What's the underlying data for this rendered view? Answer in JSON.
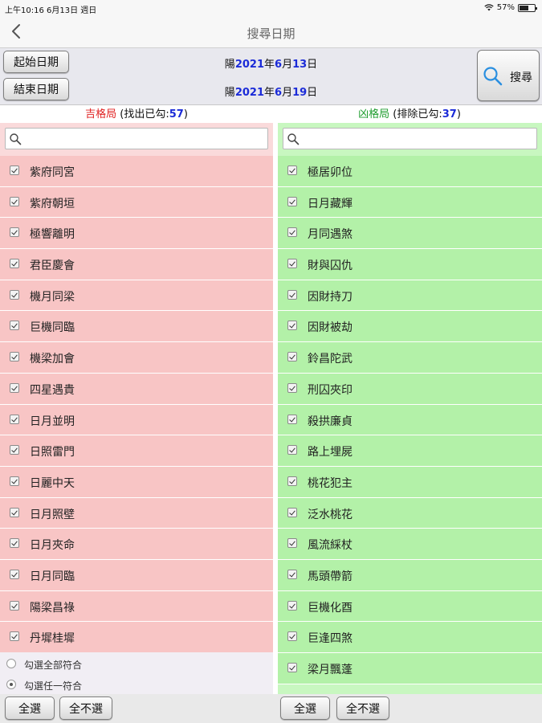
{
  "status_bar": {
    "time_date": "上午10:16  6月13日 週日",
    "battery": "57%"
  },
  "nav": {
    "title": "搜尋日期"
  },
  "date_bar": {
    "start_button": "起始日期",
    "end_button": "結束日期",
    "start_prefix": "陽",
    "start_year": "2021",
    "start_y_suffix": "年",
    "start_month": "6",
    "start_m_suffix": "月",
    "start_day": "13",
    "start_d_suffix": "日",
    "end_prefix": "陽",
    "end_year": "2021",
    "end_y_suffix": "年",
    "end_month": "6",
    "end_m_suffix": "月",
    "end_day": "19",
    "end_d_suffix": "日",
    "search_button": "搜尋"
  },
  "left_panel": {
    "title": "吉格局",
    "subtitle_pre": " (找出已勾:",
    "count": "57",
    "subtitle_post": ")",
    "search_placeholder": "",
    "items": [
      "紫府同宮",
      "紫府朝垣",
      "極響離明",
      "君臣慶會",
      "機月同梁",
      "巨機同臨",
      "機梁加會",
      "四星遇貴",
      "日月並明",
      "日照雷門",
      "日麗中天",
      "日月照壁",
      "日月夾命",
      "日月同臨",
      "陽梁昌祿",
      "丹墀桂墀"
    ],
    "radio_all": "勾選全部符合",
    "radio_any": "勾選任一符合"
  },
  "right_panel": {
    "title": "凶格局",
    "subtitle_pre": " (排除已勾:",
    "count": "37",
    "subtitle_post": ")",
    "search_placeholder": "",
    "items": [
      "極居卯位",
      "日月藏輝",
      "月同遇煞",
      "財與囚仇",
      "因財持刀",
      "因財被劫",
      "鈴昌陀武",
      "刑囚夾印",
      "殺拱廉貞",
      "路上埋屍",
      "桃花犯主",
      "泛水桃花",
      "風流綵杖",
      "馬頭帶箭",
      "巨機化酉",
      "巨逢四煞",
      "梁月飄蓬"
    ]
  },
  "bottom_bar": {
    "left_select_all": "全選",
    "left_select_none": "全不選",
    "right_select_all": "全選",
    "right_select_none": "全不選"
  },
  "colors": {
    "left_bg": "#f8c5c5",
    "right_bg": "#b3f1a8",
    "accent_blue": "#1b2bd8",
    "good_red": "#e02020",
    "bad_green": "#1f9d2f"
  }
}
